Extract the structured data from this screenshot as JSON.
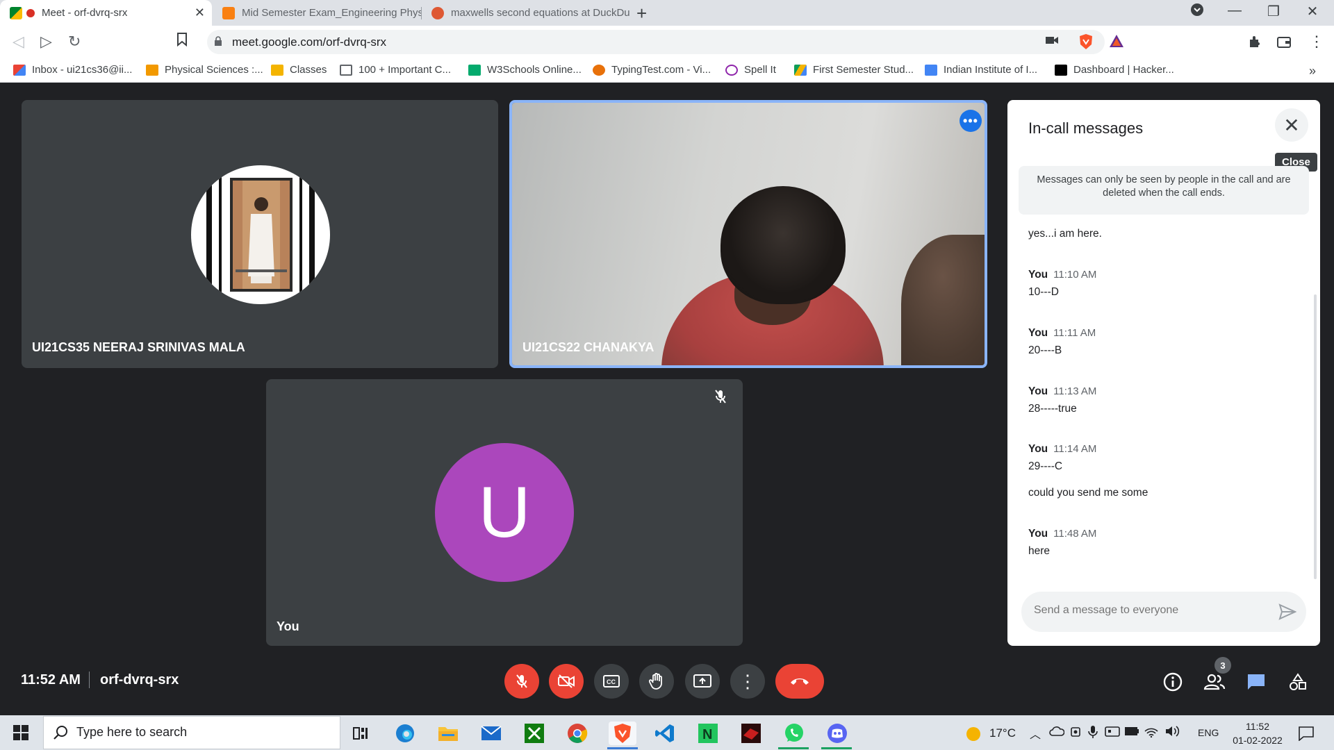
{
  "browser": {
    "tabs": [
      {
        "title": "Meet - orf-dvrq-srx",
        "active": true
      },
      {
        "title": "Mid Semester Exam_Engineering Phys"
      },
      {
        "title": "maxwells second equations at DuckDu"
      }
    ],
    "new_tab_label": "+",
    "url": "meet.google.com/orf-dvrq-srx",
    "bookmarks": [
      {
        "label": "Inbox - ui21cs36@ii...",
        "icon": "gmail-icon",
        "color": "#ea4335"
      },
      {
        "label": "Physical Sciences :...",
        "icon": "star-icon",
        "color": "#f29900"
      },
      {
        "label": "Classes",
        "icon": "classroom-icon",
        "color": "#f4b400"
      },
      {
        "label": "100 + Important C...",
        "icon": "book-icon",
        "color": "#5f6368"
      },
      {
        "label": "W3Schools Online...",
        "icon": "w3schools-icon",
        "color": "#04aa6d"
      },
      {
        "label": "TypingTest.com - Vi...",
        "icon": "typingtest-icon",
        "color": "#e8710a"
      },
      {
        "label": "Spell It",
        "icon": "spellit-icon",
        "color": "#8e24aa"
      },
      {
        "label": "First Semester Stud...",
        "icon": "drive-icon",
        "color": "#1a73e8"
      },
      {
        "label": "Indian Institute of I...",
        "icon": "calendar-icon",
        "color": "#4285f4"
      },
      {
        "label": "Dashboard | Hacker...",
        "icon": "hackerrank-icon",
        "color": "#000000"
      }
    ],
    "more_bookmarks": "»"
  },
  "participants": [
    {
      "name": "UI21CS35 NEERAJ SRINIVAS MALA"
    },
    {
      "name": "UI21CS22 CHANAKYA",
      "speaking": true
    },
    {
      "name": "You",
      "initial": "U",
      "avatar_color": "#ab47bc",
      "muted": true
    }
  ],
  "chat": {
    "title": "In-call messages",
    "close_tooltip": "Close",
    "notice": "Messages can only be seen by people in the call and are deleted when the call ends.",
    "messages": [
      {
        "sender": "",
        "time": "",
        "text": "yes...i am here."
      },
      {
        "sender": "You",
        "time": "11:10 AM",
        "text": "10---D"
      },
      {
        "sender": "You",
        "time": "11:11 AM",
        "text": "20----B"
      },
      {
        "sender": "You",
        "time": "11:13 AM",
        "text": "28-----true"
      },
      {
        "sender": "You",
        "time": "11:14 AM",
        "text": "29----C"
      },
      {
        "sender": "",
        "time": "",
        "text": "could you send me some"
      },
      {
        "sender": "You",
        "time": "11:48 AM",
        "text": "here"
      }
    ],
    "input_placeholder": "Send a message to everyone"
  },
  "meeting": {
    "time": "11:52 AM",
    "code": "orf-dvrq-srx",
    "people_count": "3"
  },
  "taskbar": {
    "search_placeholder": "Type here to search",
    "weather": "17°C",
    "language": "ENG",
    "time": "11:52",
    "date": "01-02-2022"
  },
  "colors": {
    "accent_blue": "#8ab4f8",
    "danger_red": "#ea4335",
    "tile_bg": "#3c4043",
    "stage_bg": "#202124"
  }
}
